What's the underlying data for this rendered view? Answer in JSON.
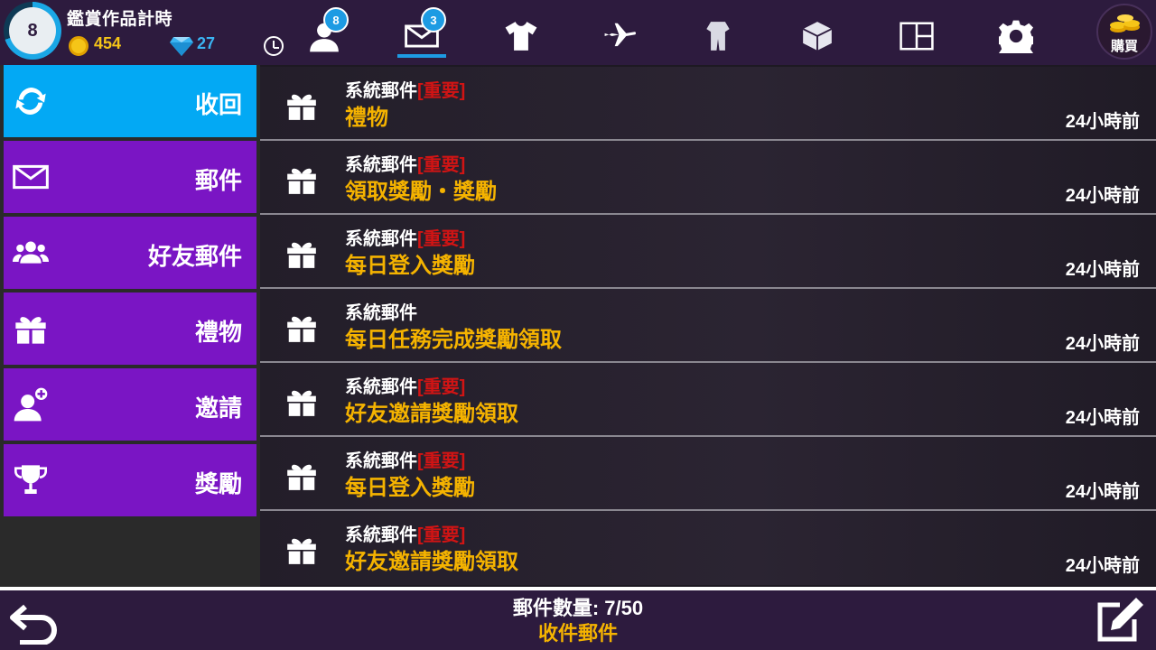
{
  "player": {
    "level": "8",
    "name": "鑑賞作品計時",
    "coins": "454",
    "gems": "27",
    "level_progress": 0.7
  },
  "nav": {
    "items": [
      {
        "name": "friends-nav",
        "icon": "person-icon",
        "badge": "8"
      },
      {
        "name": "mail-nav",
        "icon": "envelope-icon",
        "badge": "3",
        "active": true
      },
      {
        "name": "wardrobe-nav",
        "icon": "shirt-icon",
        "badge": ""
      },
      {
        "name": "travel-nav",
        "icon": "airplane-icon",
        "badge": ""
      },
      {
        "name": "outfits-nav",
        "icon": "outfit-icon",
        "badge": ""
      },
      {
        "name": "inventory-nav",
        "icon": "box-icon",
        "badge": ""
      },
      {
        "name": "layout-nav",
        "icon": "layout-icon",
        "badge": ""
      },
      {
        "name": "settings-nav",
        "icon": "gear-icon",
        "badge": ""
      }
    ],
    "gold_label": "購買"
  },
  "menu": {
    "items": [
      {
        "label": "收回",
        "icon": "refresh-icon",
        "active": true
      },
      {
        "label": "郵件",
        "icon": "envelope-icon",
        "active": false
      },
      {
        "label": "好友郵件",
        "icon": "group-icon",
        "active": false
      },
      {
        "label": "禮物",
        "icon": "gift-icon",
        "active": false
      },
      {
        "label": "邀請",
        "icon": "add-friend-icon",
        "active": false
      },
      {
        "label": "獎勵",
        "icon": "trophy-icon",
        "active": false
      }
    ]
  },
  "mails": [
    {
      "sender": "系統郵件",
      "tag": "[重要]",
      "subject": "禮物",
      "time": "24小時前"
    },
    {
      "sender": "系統郵件",
      "tag": "[重要]",
      "subject": "領取獎勵・獎勵",
      "time": "24小時前"
    },
    {
      "sender": "系統郵件",
      "tag": "[重要]",
      "subject": "每日登入獎勵",
      "time": "24小時前"
    },
    {
      "sender": "系統郵件",
      "tag": "",
      "subject": "每日任務完成獎勵領取",
      "time": "24小時前"
    },
    {
      "sender": "系統郵件",
      "tag": "[重要]",
      "subject": "好友邀請獎勵領取",
      "time": "24小時前"
    },
    {
      "sender": "系統郵件",
      "tag": "[重要]",
      "subject": "每日登入獎勵",
      "time": "24小時前"
    },
    {
      "sender": "系統郵件",
      "tag": "[重要]",
      "subject": "好友邀請獎勵領取",
      "time": "24小時前"
    }
  ],
  "footer": {
    "count_text": "郵件數量: 7/50",
    "status_text": "收件郵件"
  },
  "colors": {
    "topbar": "#2d1b3e",
    "menu_active": "#03a9f4",
    "menu_item": "#7a15c4",
    "subject": "#f5b300",
    "tag": "#d11414",
    "accent": "#1d9be3"
  }
}
